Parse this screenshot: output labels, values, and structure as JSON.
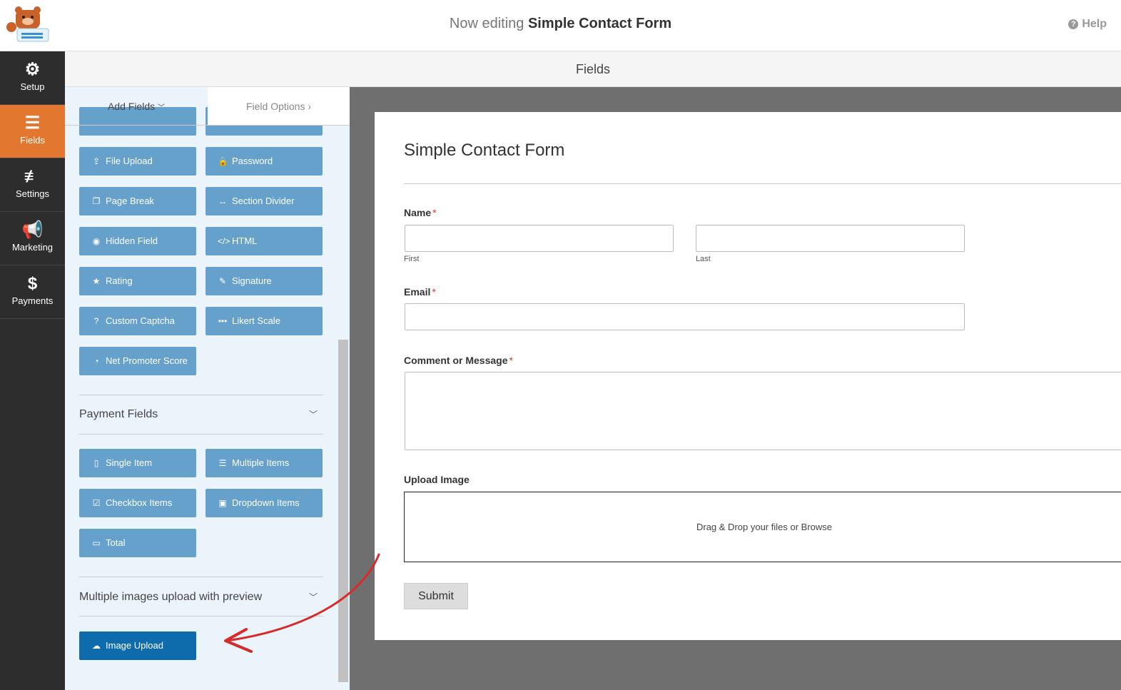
{
  "header": {
    "prefix": "Now editing",
    "form_name": "Simple Contact Form",
    "help": "Help"
  },
  "sidebar": {
    "items": [
      {
        "label": "Setup",
        "icon": "gear-icon"
      },
      {
        "label": "Fields",
        "icon": "list-icon",
        "active": true
      },
      {
        "label": "Settings",
        "icon": "sliders-icon"
      },
      {
        "label": "Marketing",
        "icon": "megaphone-icon"
      },
      {
        "label": "Payments",
        "icon": "dollar-icon"
      }
    ]
  },
  "fields_bar": "Fields",
  "tabs": {
    "add": "Add Fields",
    "options": "Field Options"
  },
  "fancy_fields": [
    {
      "label": "File Upload",
      "icon": "upload-icon"
    },
    {
      "label": "Password",
      "icon": "lock-icon"
    },
    {
      "label": "Page Break",
      "icon": "copy-icon"
    },
    {
      "label": "Section Divider",
      "icon": "arrows-h-icon"
    },
    {
      "label": "Hidden Field",
      "icon": "eye-slash-icon"
    },
    {
      "label": "HTML",
      "icon": "code-icon"
    },
    {
      "label": "Rating",
      "icon": "star-icon"
    },
    {
      "label": "Signature",
      "icon": "pencil-icon"
    },
    {
      "label": "Custom Captcha",
      "icon": "question-icon"
    },
    {
      "label": "Likert Scale",
      "icon": "ellipsis-icon"
    },
    {
      "label": "Net Promoter Score",
      "icon": "gauge-icon"
    }
  ],
  "payment_section": "Payment Fields",
  "payment_fields": [
    {
      "label": "Single Item",
      "icon": "file-icon"
    },
    {
      "label": "Multiple Items",
      "icon": "list-icon"
    },
    {
      "label": "Checkbox Items",
      "icon": "check-square-icon"
    },
    {
      "label": "Dropdown Items",
      "icon": "caret-square-icon"
    },
    {
      "label": "Total",
      "icon": "money-icon"
    }
  ],
  "addon_section": "Multiple images upload with preview",
  "addon_button": "Image Upload",
  "form": {
    "title": "Simple Contact Form",
    "name_label": "Name",
    "first": "First",
    "last": "Last",
    "email_label": "Email",
    "comment_label": "Comment or Message",
    "required": "*",
    "upload_label": "Upload Image",
    "upload_text": "Drag & Drop your files or Browse",
    "submit": "Submit"
  },
  "colors": {
    "accent": "#e27730",
    "button": "#66a1cc",
    "button_active": "#0e6cad",
    "arrow": "#d62b2b"
  }
}
